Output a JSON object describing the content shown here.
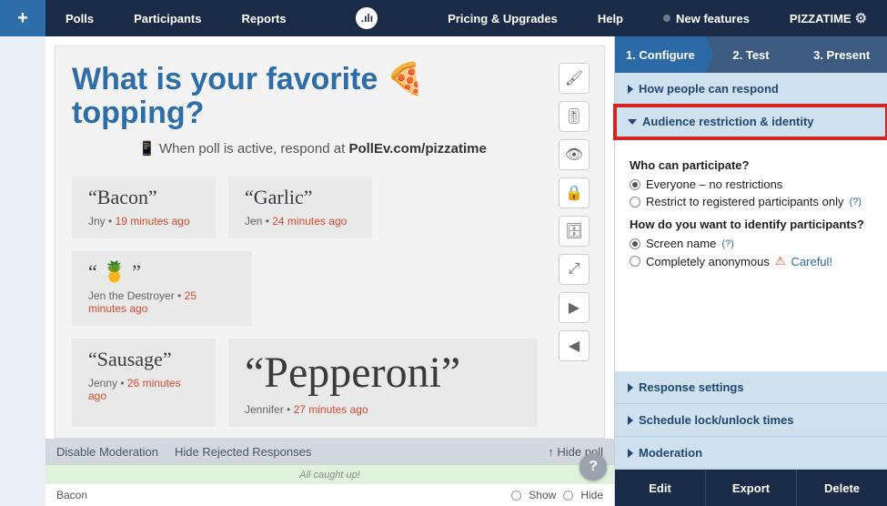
{
  "nav": {
    "polls": "Polls",
    "participants": "Participants",
    "reports": "Reports",
    "pricing": "Pricing & Upgrades",
    "help": "Help",
    "newfeatures": "New features",
    "user": "PIZZATIME"
  },
  "poll": {
    "title_pre": "What is your favorite ",
    "title_post": " topping?",
    "emoji": "🍕",
    "respond_prefix": "When poll is active, respond at ",
    "respond_url": "PollEv.com/pizzatime"
  },
  "cards": [
    {
      "answer": "“Bacon”",
      "author": "Jny",
      "time": "19 minutes ago"
    },
    {
      "answer": "“Garlic”",
      "author": "Jen",
      "time": "24 minutes ago"
    },
    {
      "answer": "“ 🍍 ”",
      "author": "Jen the Destroyer",
      "time": "25 minutes ago"
    },
    {
      "answer": "“Sausage”",
      "author": "Jenny",
      "time": "26 minutes ago"
    },
    {
      "answer": "“Pepperoni”",
      "author": "Jennifer",
      "time": "27 minutes ago"
    }
  ],
  "modbar": {
    "disable": "Disable Moderation",
    "hide_rejected": "Hide Rejected Responses",
    "hide_poll": "↑ Hide poll"
  },
  "caught": "All caught up!",
  "strip": {
    "item": "Bacon",
    "show": "Show",
    "hide": "Hide"
  },
  "steps": {
    "s1": "1. Configure",
    "s2": "2. Test",
    "s3": "3. Present"
  },
  "sections": {
    "respond": "How people can respond",
    "audience": "Audience restriction & identity",
    "response": "Response settings",
    "schedule": "Schedule lock/unlock times",
    "moderation": "Moderation"
  },
  "audience": {
    "q1": "Who can participate?",
    "q1o1": "Everyone – no restrictions",
    "q1o2": "Restrict to registered participants only",
    "q2": "How do you want to identify participants?",
    "q2o1": "Screen name",
    "q2o2_a": "Completely anonymous",
    "q2o2_warn": "⚠",
    "q2o2_b": "Careful!",
    "hint": "(?)"
  },
  "actions": {
    "edit": "Edit",
    "export": "Export",
    "delete": "Delete"
  }
}
